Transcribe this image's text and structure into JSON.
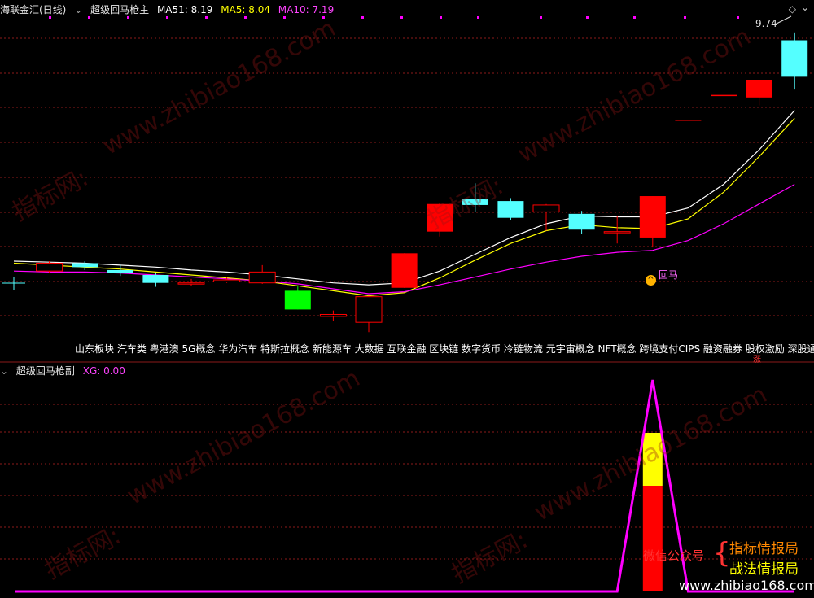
{
  "top_panel": {
    "stock_name": "海联金汇(日线)",
    "indicator_name": "超级回马枪主",
    "ma51_label": "MA51: 8.19",
    "ma5_label": "MA5: 8.04",
    "ma10_label": "MA10: 7.19",
    "high_label": "9.74",
    "signal_label": "回马",
    "concepts_text": "山东板块 汽车类 粤港澳 5G概念 华为汽车 特斯拉概念 新能源车 大数据 互联金融 区块链 数字货币 冷链物流 元宇宙概念 NFT概念 跨境支付CIPS 融资融券 股权激励 深股通标",
    "zhang_label": "涨"
  },
  "bottom_panel": {
    "indicator_name": "超级回马枪副",
    "xg_label": "XG: 0.00"
  },
  "branding": {
    "wechat_label": "微信公众号",
    "brand1": "指标情报局",
    "brand2": "战法情报局",
    "site": "www.zhibiao168.com",
    "watermark_site": "www.zhibiao168.com",
    "watermark_cn": "指标网:"
  },
  "colors": {
    "up": "#ff0000",
    "down_cyan": "#54ffff",
    "down_green": "#00ff00",
    "ma51": "#ffffff",
    "ma5": "#ffff00",
    "ma10": "#ff00ff",
    "grid": "#8b1a1a"
  },
  "chart_data": [
    {
      "type": "candlestick",
      "title": "超级回马枪主",
      "candles": [
        {
          "o": null,
          "c": null,
          "h": null,
          "l": null,
          "style": "cross"
        },
        {
          "o": 7.32,
          "c": 7.4,
          "h": 7.42,
          "l": 7.3,
          "style": "hollow"
        },
        {
          "o": 7.4,
          "c": 7.36,
          "h": 7.42,
          "l": 7.33,
          "style": "cyan"
        },
        {
          "o": 7.33,
          "c": 7.3,
          "h": 7.38,
          "l": 7.27,
          "style": "cyan"
        },
        {
          "o": 7.28,
          "c": 7.2,
          "h": 7.3,
          "l": 7.16,
          "style": "cyan"
        },
        {
          "o": 7.2,
          "c": 7.19,
          "h": 7.24,
          "l": 7.17,
          "style": "hollow"
        },
        {
          "o": 7.21,
          "c": 7.23,
          "h": 7.26,
          "l": 7.2,
          "style": "hollow"
        },
        {
          "o": 7.2,
          "c": 7.31,
          "h": 7.38,
          "l": 7.19,
          "style": "hollow"
        },
        {
          "o": 7.12,
          "c": 6.93,
          "h": 7.17,
          "l": 6.93,
          "style": "green"
        },
        {
          "o": 6.86,
          "c": 6.88,
          "h": 6.92,
          "l": 6.81,
          "style": "hollow"
        },
        {
          "o": 6.8,
          "c": 7.06,
          "h": 7.07,
          "l": 6.7,
          "style": "hollow"
        },
        {
          "o": 7.15,
          "c": 7.5,
          "h": 7.5,
          "l": 7.15,
          "style": "red"
        },
        {
          "o": 7.72,
          "c": 8.0,
          "h": 8.01,
          "l": 7.67,
          "style": "red"
        },
        {
          "o": 8.05,
          "c": 7.99,
          "h": 8.21,
          "l": 7.92,
          "style": "cyan"
        },
        {
          "o": 8.03,
          "c": 7.86,
          "h": 8.06,
          "l": 7.84,
          "style": "cyan"
        },
        {
          "o": 7.92,
          "c": 7.99,
          "h": 8.0,
          "l": 7.73,
          "style": "hollow"
        },
        {
          "o": 7.9,
          "c": 7.74,
          "h": 7.93,
          "l": 7.7,
          "style": "cyan"
        },
        {
          "o": 7.72,
          "c": 7.71,
          "h": 7.88,
          "l": 7.6,
          "style": "hollow"
        },
        {
          "o": 7.66,
          "c": 8.08,
          "h": 8.08,
          "l": 7.56,
          "style": "red"
        },
        {
          "o": 8.85,
          "c": 8.85,
          "h": 8.85,
          "l": 8.85,
          "style": "flat"
        },
        {
          "o": 9.1,
          "c": 9.1,
          "h": 9.1,
          "l": 9.1,
          "style": "flat"
        },
        {
          "o": 9.08,
          "c": 9.26,
          "h": 9.26,
          "l": 9.0,
          "style": "red"
        },
        {
          "o": 9.29,
          "c": 9.66,
          "h": 9.74,
          "l": 9.16,
          "style": "cyan"
        }
      ],
      "series": [
        {
          "name": "MA51",
          "values": [
            7.42,
            7.41,
            7.4,
            7.38,
            7.36,
            7.33,
            7.31,
            7.28,
            7.24,
            7.2,
            7.18,
            7.2,
            7.32,
            7.49,
            7.66,
            7.8,
            7.88,
            7.87,
            7.87,
            7.96,
            8.2,
            8.55,
            8.95
          ]
        },
        {
          "name": "MA5",
          "values": [
            7.4,
            7.38,
            7.36,
            7.34,
            7.31,
            7.28,
            7.25,
            7.22,
            7.17,
            7.12,
            7.07,
            7.1,
            7.25,
            7.43,
            7.6,
            7.73,
            7.79,
            7.76,
            7.75,
            7.85,
            8.12,
            8.48,
            8.87
          ]
        },
        {
          "name": "MA10",
          "values": [
            7.32,
            7.31,
            7.31,
            7.3,
            7.28,
            7.26,
            7.24,
            7.22,
            7.19,
            7.14,
            7.09,
            7.11,
            7.18,
            7.26,
            7.34,
            7.41,
            7.47,
            7.51,
            7.53,
            7.63,
            7.8,
            8.0,
            8.2
          ]
        }
      ],
      "ylim": [
        6.62,
        9.92
      ]
    },
    {
      "type": "line",
      "title": "超级回马枪副",
      "series": [
        {
          "name": "XG",
          "values": [
            0,
            0,
            0,
            0,
            0,
            0,
            0,
            0,
            0,
            0,
            0,
            0,
            0,
            0,
            0,
            0,
            0,
            0,
            0.8,
            0,
            0,
            0,
            0
          ]
        }
      ],
      "bar": {
        "index": 18,
        "yellow": [
          0.4,
          0.6
        ],
        "red": [
          0,
          0.4
        ]
      },
      "ylim": [
        0,
        1
      ]
    }
  ]
}
